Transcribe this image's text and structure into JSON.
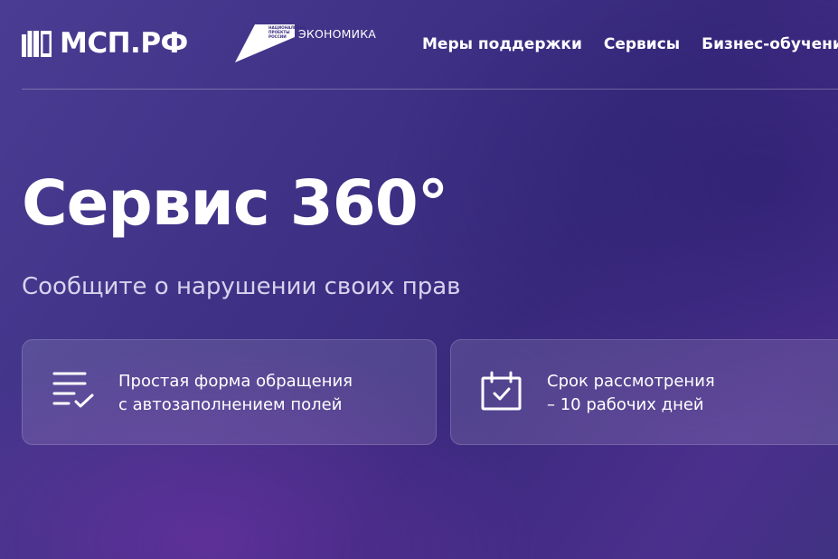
{
  "header": {
    "logo_text": "МСП.РФ",
    "np_logo_text": "НАЦИОНАЛЬНЫЕ\nПРОЕКТЫ\nРОССИИ",
    "np_caption": "ЭКОНОМИКА",
    "nav": [
      {
        "label": "Меры поддержки"
      },
      {
        "label": "Сервисы"
      },
      {
        "label": "Бизнес-обучение"
      }
    ]
  },
  "hero": {
    "title": "Сервис 360°",
    "subtitle": "Сообщите о нарушении своих прав"
  },
  "features": [
    {
      "icon": "checklist-icon",
      "line1": "Простая форма обращения",
      "line2": "с автозаполнением полей"
    },
    {
      "icon": "calendar-check-icon",
      "line1": "Срок рассмотрения",
      "line2": "– 10 рабочих дней"
    }
  ],
  "colors": {
    "background_start": "#4a3c92",
    "background_end": "#3a2a7e",
    "accent_purple": "#7832aa",
    "text": "#ffffff",
    "subtitle_text": "#d8d2ee"
  }
}
